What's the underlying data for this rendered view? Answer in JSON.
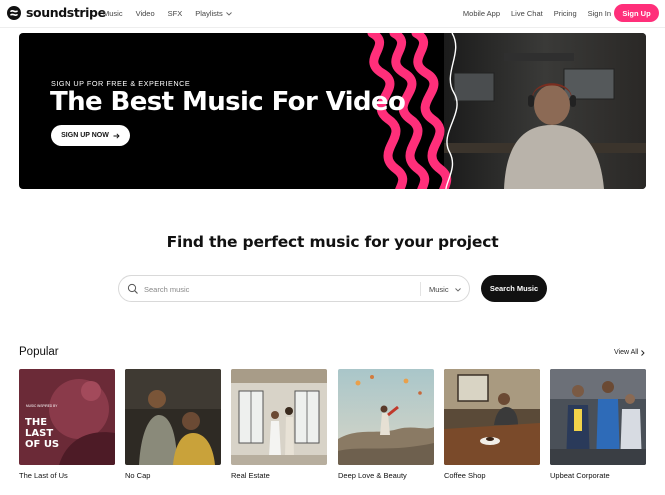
{
  "brand": {
    "name": "soundstripe",
    "accent": "#ff2f7a"
  },
  "nav": {
    "left": [
      {
        "label": "Music"
      },
      {
        "label": "Video"
      },
      {
        "label": "SFX"
      },
      {
        "label": "Playlists",
        "dropdown": true
      }
    ],
    "right": [
      {
        "label": "Mobile App"
      },
      {
        "label": "Live Chat"
      },
      {
        "label": "Pricing"
      },
      {
        "label": "Sign In"
      }
    ],
    "signup_label": "Sign Up"
  },
  "hero": {
    "eyebrow": "SIGN UP FOR FREE & EXPERIENCE",
    "title": "The Best Music For Video",
    "cta_label": "SIGN UP NOW",
    "cta_icon": "arrow-right-icon"
  },
  "search": {
    "heading": "Find the perfect music for your project",
    "placeholder": "Search music",
    "value": "",
    "type_selected": "Music",
    "button_label": "Search Music"
  },
  "popular": {
    "title": "Popular",
    "view_all_label": "View All",
    "cover_text": {
      "top": "MUSIC INSPIRED BY",
      "main1": "THE",
      "main2": "LAST",
      "main3": "OF US"
    },
    "items": [
      {
        "label": "The Last of Us"
      },
      {
        "label": "No Cap"
      },
      {
        "label": "Real Estate"
      },
      {
        "label": "Deep Love & Beauty"
      },
      {
        "label": "Coffee Shop"
      },
      {
        "label": "Upbeat Corporate"
      }
    ]
  }
}
